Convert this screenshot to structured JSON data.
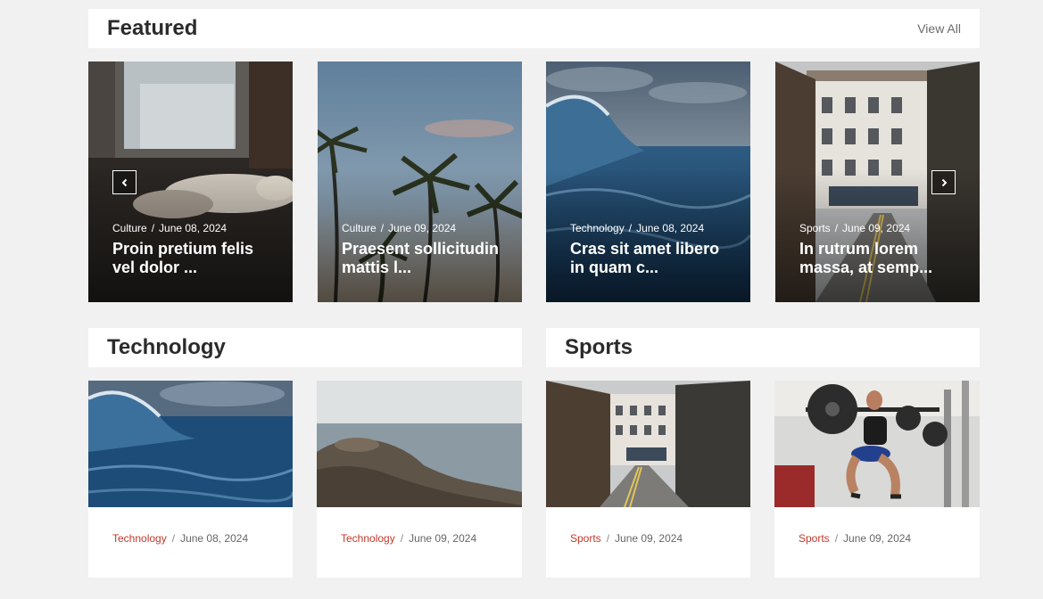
{
  "featured": {
    "title": "Featured",
    "view_all": "View All",
    "cards": [
      {
        "category": "Culture",
        "date": "June 08, 2024",
        "title": "Proin pretium felis vel dolor ..."
      },
      {
        "category": "Culture",
        "date": "June 09, 2024",
        "title": "Praesent sollicitudin mattis l..."
      },
      {
        "category": "Technology",
        "date": "June 08, 2024",
        "title": "Cras sit amet libero in quam c..."
      },
      {
        "category": "Sports",
        "date": "June 09, 2024",
        "title": "In rutrum lorem massa, at semp..."
      }
    ]
  },
  "technology": {
    "title": "Technology",
    "cards": [
      {
        "category": "Technology",
        "date": "June 08, 2024"
      },
      {
        "category": "Technology",
        "date": "June 09, 2024"
      }
    ]
  },
  "sports": {
    "title": "Sports",
    "cards": [
      {
        "category": "Sports",
        "date": "June 09, 2024"
      },
      {
        "category": "Sports",
        "date": "June 09, 2024"
      }
    ]
  },
  "icons": {
    "prev": "chevron-left-icon",
    "next": "chevron-right-icon"
  },
  "colors": {
    "accent": "#c0392b",
    "background": "#f1f1f1",
    "heading": "#2b2b2b"
  }
}
